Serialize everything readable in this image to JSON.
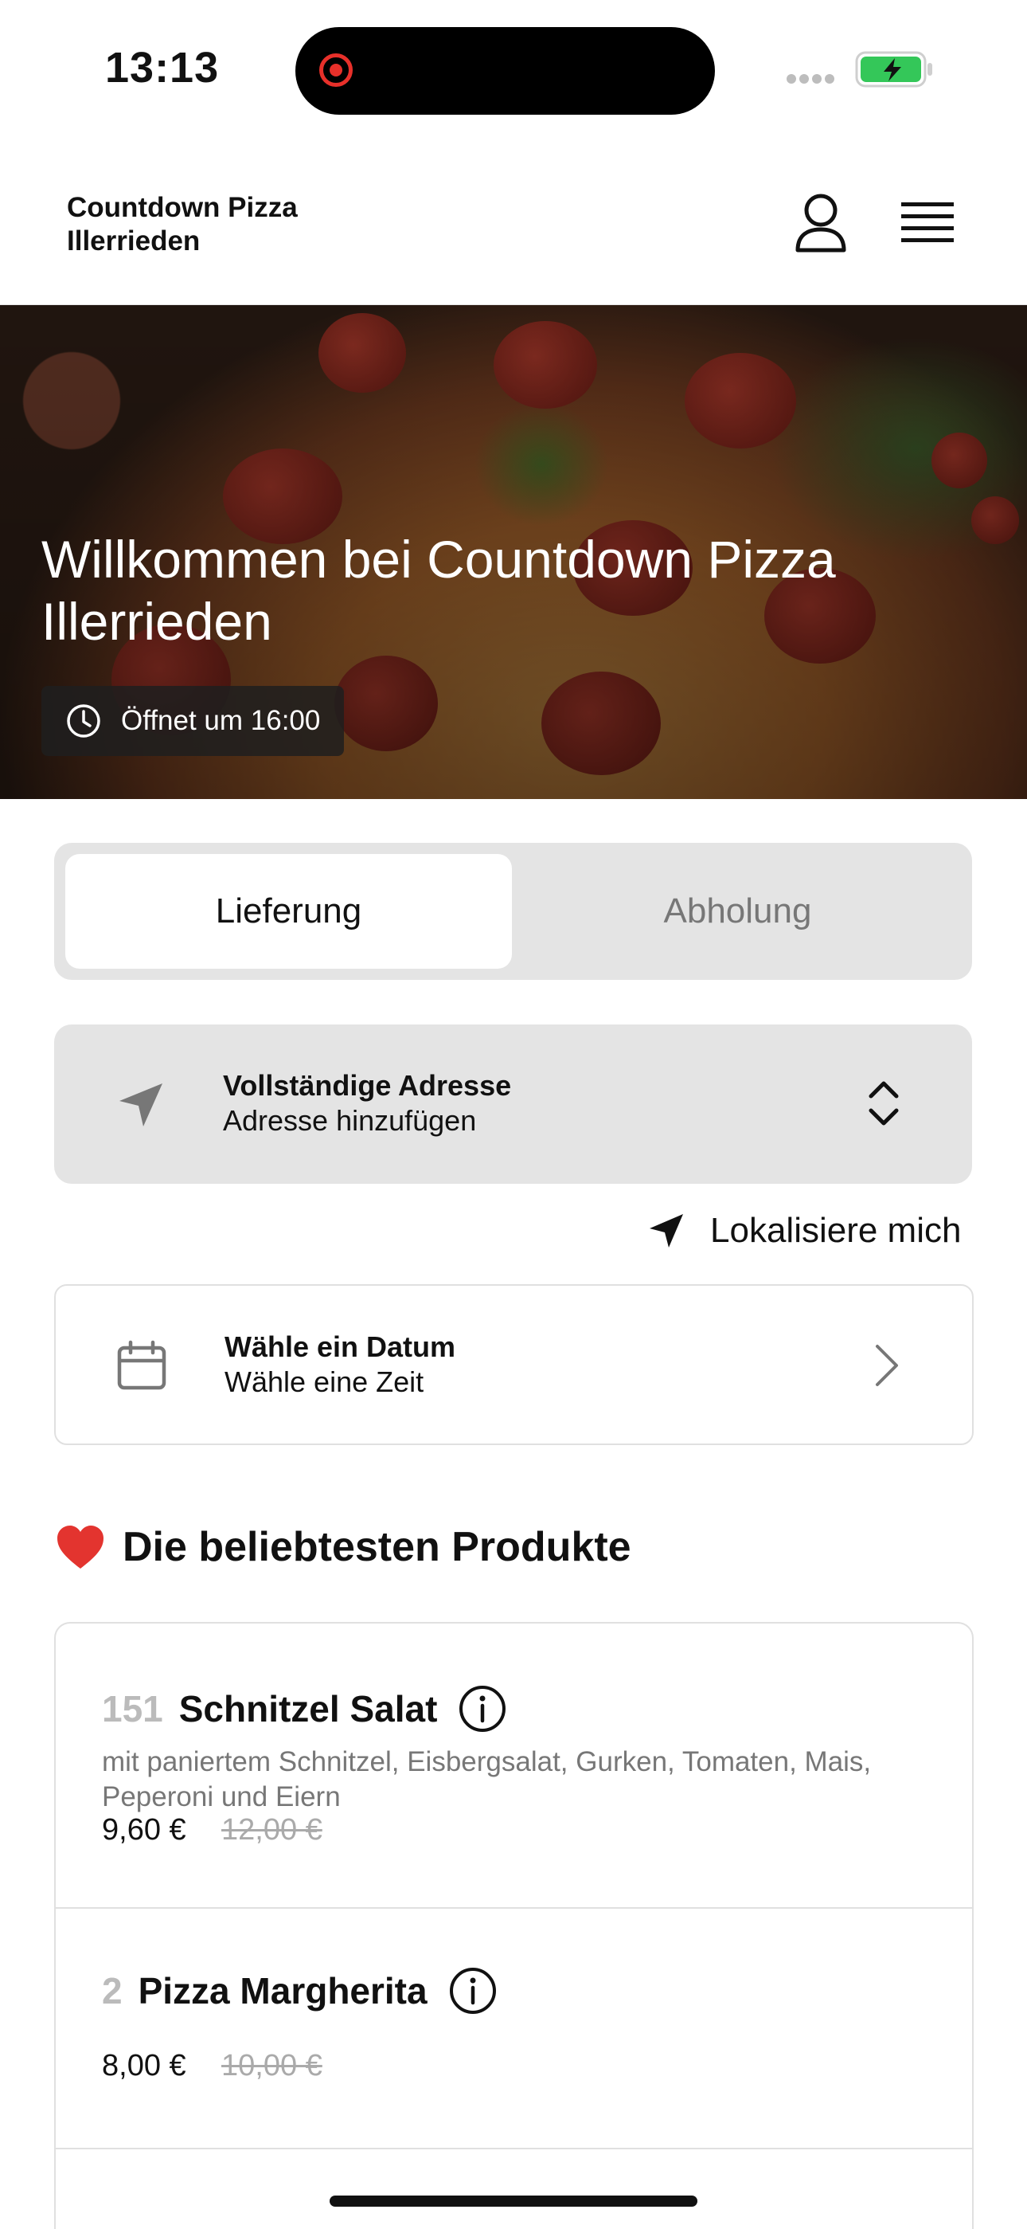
{
  "status_bar": {
    "time": "13:13"
  },
  "header": {
    "brand_line1": "Countdown Pizza",
    "brand_line2": "Illerrieden"
  },
  "hero": {
    "title": "Willkommen bei Countdown Pizza Illerrieden",
    "hours": "Öffnet um 16:00"
  },
  "mode_tabs": {
    "delivery": "Lieferung",
    "pickup": "Abholung",
    "selected": "Lieferung"
  },
  "address": {
    "title": "Vollständige Adresse",
    "subtitle": "Adresse hinzufügen"
  },
  "locate": {
    "label": "Lokalisiere mich"
  },
  "date": {
    "title": "Wähle ein Datum",
    "subtitle": "Wähle eine Zeit"
  },
  "popular": {
    "title": "Die beliebtesten Produkte"
  },
  "products": [
    {
      "number": "151",
      "name": "Schnitzel Salat",
      "description": "mit paniertem Schnitzel, Eisbergsalat, Gurken, Tomaten, Mais, Peperoni und Eiern",
      "price": "9,60 €",
      "old_price": "12,00 €"
    },
    {
      "number": "2",
      "name": "Pizza Margherita",
      "description": "",
      "price": "8,00 €",
      "old_price": "10,00 €"
    }
  ],
  "colors": {
    "accent_record": "#e8302a",
    "battery_green": "#34c759",
    "segment_bg": "#e4e4e4"
  },
  "icons": [
    "record-icon",
    "battery-icon",
    "user-icon",
    "menu-icon",
    "clock-icon",
    "navigation-icon",
    "updown-chevron-icon",
    "location-arrow-icon",
    "calendar-icon",
    "chevron-right-icon",
    "heart-icon",
    "info-icon"
  ]
}
